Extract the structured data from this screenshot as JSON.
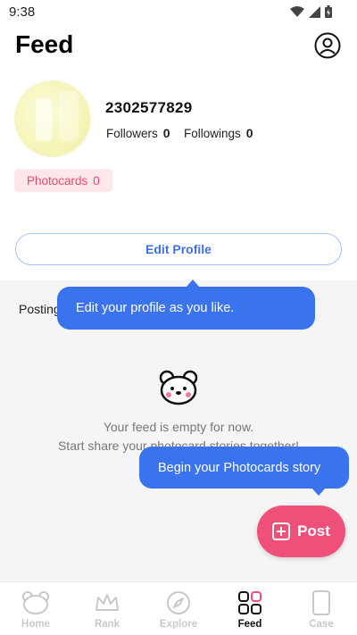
{
  "status_bar": {
    "time": "9:38",
    "icons": [
      "wifi-icon",
      "signal-icon",
      "battery-icon"
    ]
  },
  "header": {
    "title": "Feed",
    "account_icon": "account-circle-icon"
  },
  "profile": {
    "user_id": "2302577829",
    "followers_label": "Followers",
    "followers_count": "0",
    "followings_label": "Followings",
    "followings_count": "0",
    "photocards_label": "Photocards",
    "photocards_count": "0",
    "edit_button": "Edit Profile"
  },
  "tabs": {
    "posting": "Posting"
  },
  "tooltips": {
    "edit": "Edit your profile as you like.",
    "story": "Begin your Photocards story"
  },
  "empty_state": {
    "icon": "bear-icon",
    "line1": "Your feed is empty for now.",
    "line2": "Start share your photocard stories together!"
  },
  "fab": {
    "label": "Post",
    "icon": "plus-square-icon"
  },
  "bottom_nav": {
    "items": [
      {
        "label": "Home",
        "icon": "bear-head-icon",
        "active": false
      },
      {
        "label": "Rank",
        "icon": "crown-icon",
        "active": false
      },
      {
        "label": "Explore",
        "icon": "compass-icon",
        "active": false
      },
      {
        "label": "Feed",
        "icon": "grid-icon",
        "active": true
      },
      {
        "label": "Case",
        "icon": "phone-case-icon",
        "active": false
      }
    ]
  },
  "colors": {
    "accent_blue": "#3a73ee",
    "accent_pink": "#ef5079",
    "badge_bg": "#ffe7ec"
  }
}
